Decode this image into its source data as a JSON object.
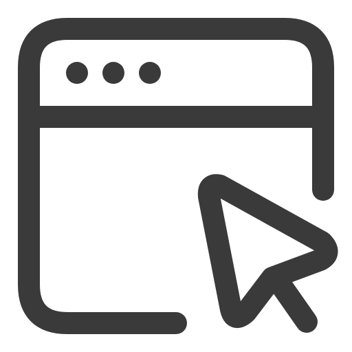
{
  "icon": {
    "name": "browser-window-click-icon",
    "stroke_color": "#3a3a3a",
    "background_color": "#ffffff"
  }
}
